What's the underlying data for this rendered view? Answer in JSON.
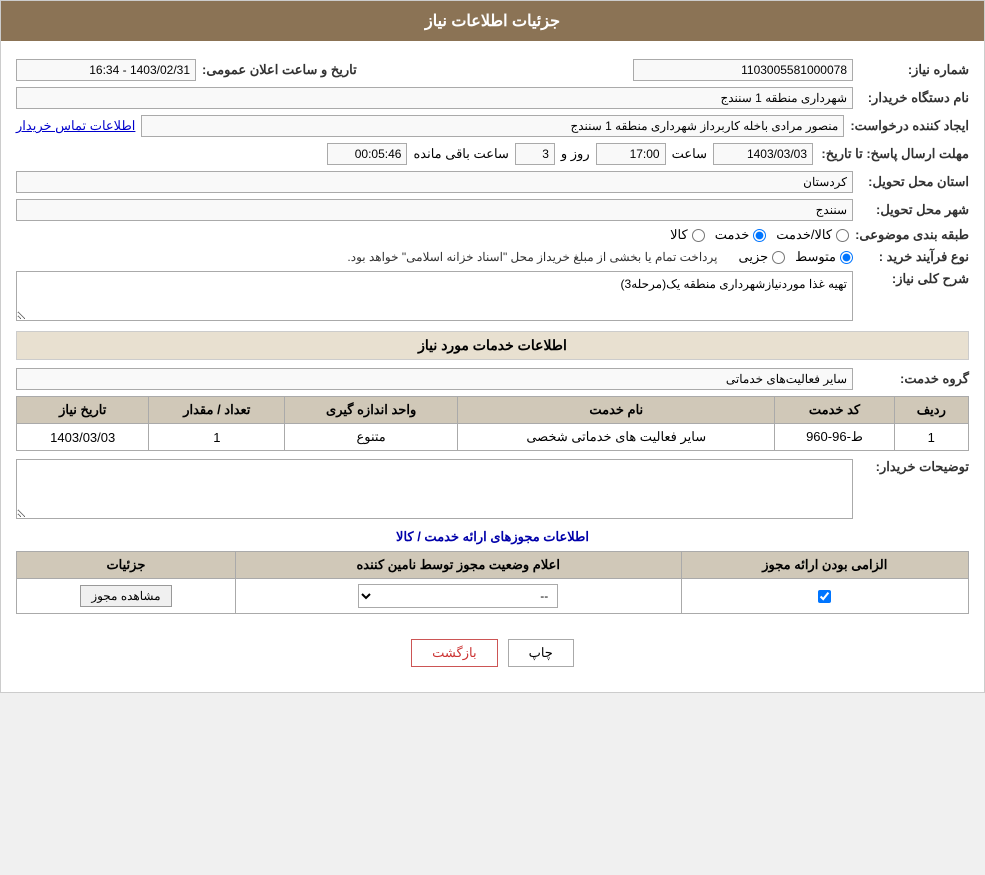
{
  "header": {
    "title": "جزئیات اطلاعات نیاز"
  },
  "need_number_label": "شماره نیاز:",
  "need_number_value": "1103005581000078",
  "announce_date_label": "تاریخ و ساعت اعلان عمومی:",
  "announce_date_value": "1403/02/31 - 16:34",
  "buyer_org_label": "نام دستگاه خریدار:",
  "buyer_org_value": "شهرداری منطقه 1 سنندج",
  "creator_label": "ایجاد کننده درخواست:",
  "creator_value": "منصور مرادی باخله کاربرداز شهرداری منطقه 1 سنندج",
  "contact_info_link": "اطلاعات تماس خریدار",
  "deadline_label": "مهلت ارسال پاسخ: تا تاریخ:",
  "deadline_date": "1403/03/03",
  "deadline_time_label": "ساعت",
  "deadline_time_value": "17:00",
  "deadline_day_label": "روز و",
  "deadline_days_value": "3",
  "remaining_label": "ساعت باقی مانده",
  "remaining_value": "00:05:46",
  "province_label": "استان محل تحویل:",
  "province_value": "کردستان",
  "city_label": "شهر محل تحویل:",
  "city_value": "سنندج",
  "category_label": "طبقه بندی موضوعی:",
  "category_options": [
    "کالا",
    "خدمت",
    "کالا/خدمت"
  ],
  "category_selected": "خدمت",
  "purchase_type_label": "نوع فرآیند خرید :",
  "purchase_type_options": [
    "جزیی",
    "متوسط"
  ],
  "purchase_note": "پرداخت تمام یا بخشی از مبلغ خریداز محل \"اسناد خزانه اسلامی\" خواهد بود.",
  "need_desc_label": "شرح کلی نیاز:",
  "need_desc_value": "تهیه غذا موردنیازشهرداری منطقه یک(مرحله3)",
  "services_section_title": "اطلاعات خدمات مورد نیاز",
  "service_group_label": "گروه خدمت:",
  "service_group_value": "سایر فعالیت‌های خدماتی",
  "services_table": {
    "columns": [
      "ردیف",
      "کد خدمت",
      "نام خدمت",
      "واحد اندازه گیری",
      "تعداد / مقدار",
      "تاریخ نیاز"
    ],
    "rows": [
      {
        "row": "1",
        "code": "ط-96-960",
        "name": "سایر فعالیت های خدماتی شخصی",
        "unit": "متنوع",
        "quantity": "1",
        "date": "1403/03/03"
      }
    ]
  },
  "buyer_notes_label": "توضیحات خریدار:",
  "buyer_notes_value": "",
  "license_section_title": "اطلاعات مجوزهای ارائه خدمت / کالا",
  "license_table": {
    "columns": [
      "الزامی بودن ارائه مجوز",
      "اعلام وضعیت مجوز توسط نامین کننده",
      "جزئیات"
    ],
    "rows": [
      {
        "required": true,
        "status": "--",
        "details_btn": "مشاهده مجوز"
      }
    ]
  },
  "btn_print": "چاپ",
  "btn_back": "بازگشت"
}
